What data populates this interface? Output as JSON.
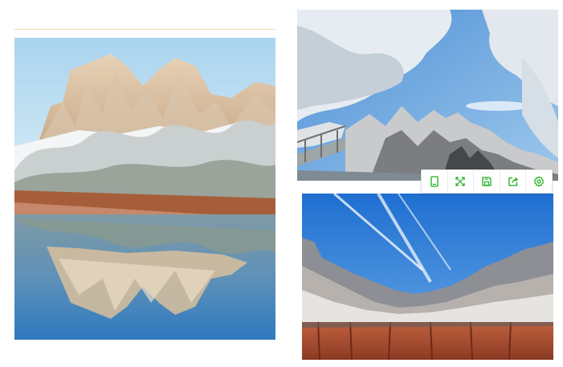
{
  "page": {
    "background": "#ffffff",
    "rule_color": "#f2d5b4"
  },
  "photos": [
    {
      "name": "snowy-cliffs-lake-reflection-photo",
      "alt": ""
    },
    {
      "name": "frosted-trees-cliff-path-photo",
      "alt": ""
    },
    {
      "name": "red-canyon-cliffs-blue-sky-photo",
      "alt": ""
    }
  ],
  "toolbar": {
    "icon_color": "#1aad19",
    "buttons": [
      {
        "icon": "phone-preview-icon",
        "title": ""
      },
      {
        "icon": "fullscreen-icon",
        "title": ""
      },
      {
        "icon": "save-icon",
        "title": ""
      },
      {
        "icon": "share-icon",
        "title": ""
      },
      {
        "icon": "gear-icon",
        "title": ""
      }
    ]
  }
}
